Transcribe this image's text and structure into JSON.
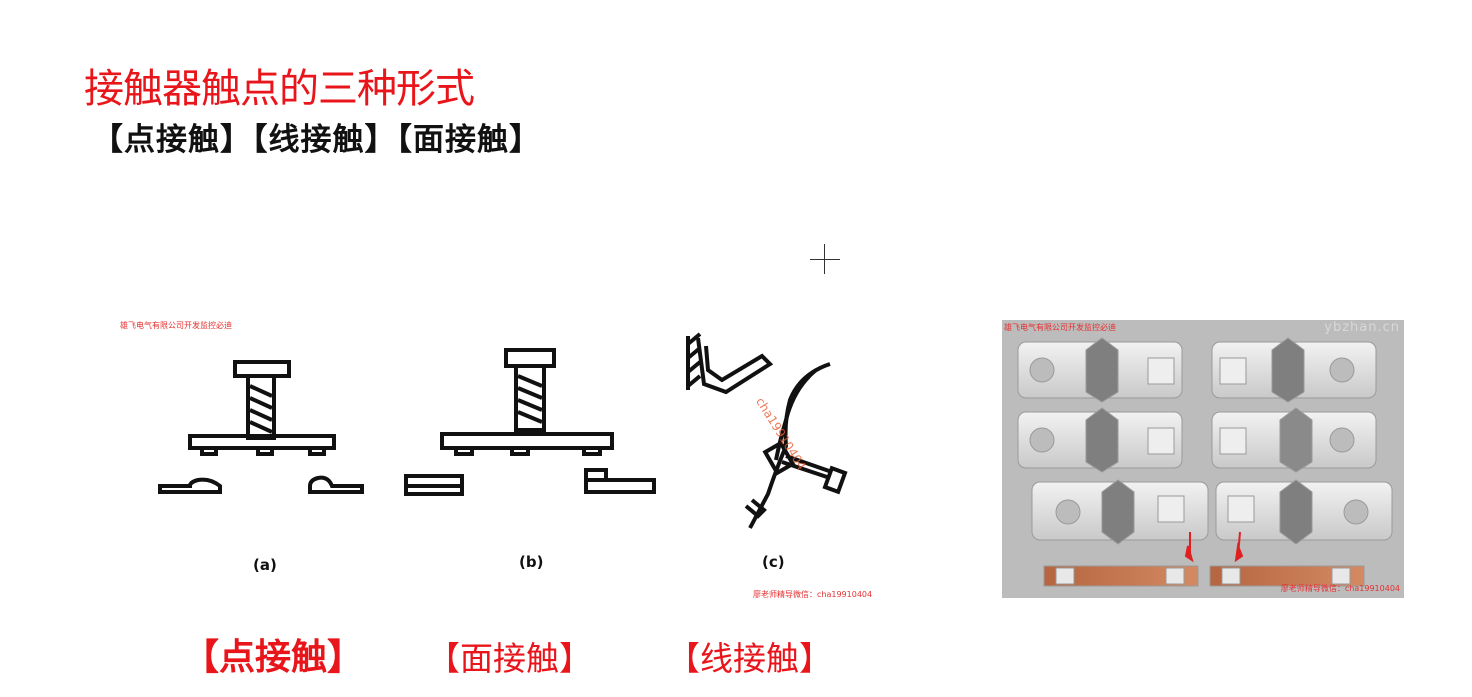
{
  "title": "接触器触点的三种形式",
  "subtitle": "【点接触】【线接触】【面接触】",
  "diagram": {
    "watermark_top": "雄飞电气有限公司开发监控必迪",
    "watermark_bottom": "廖老师精导微信：cha19910404",
    "label_a": "(a)",
    "label_b": "(b)",
    "label_c": "(c)",
    "watermark_rotated": "cha19910404"
  },
  "photo": {
    "watermark_top_left": "雄飞电气有限公司开发监控必迪",
    "watermark_top_right": "ybzhan.cn",
    "watermark_bottom_right": "廖老师精导微信：cha19910404"
  },
  "bottom_labels": [
    "【点接触】",
    "【面接触】",
    "【线接触】"
  ]
}
